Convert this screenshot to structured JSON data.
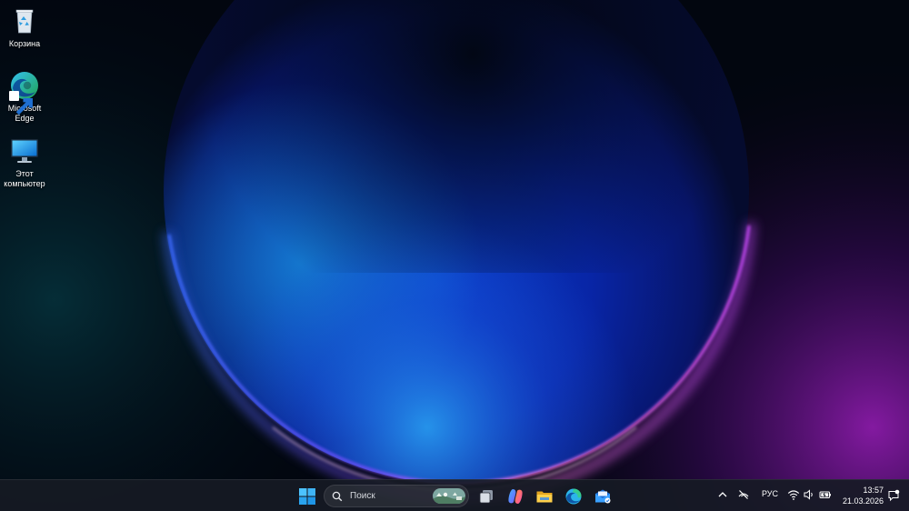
{
  "desktop": {
    "icons": [
      {
        "id": "recycle-bin",
        "label": "Корзина",
        "icon": "recycle-bin-icon"
      },
      {
        "id": "microsoft-edge",
        "label": "Microsoft Edge",
        "icon": "edge-icon"
      },
      {
        "id": "this-pc",
        "label": "Этот компьютер",
        "icon": "monitor-icon"
      }
    ]
  },
  "taskbar": {
    "start_icon": "windows-logo-icon",
    "search": {
      "placeholder": "Поиск",
      "icon": "search-icon",
      "highlight_icon": "search-highlight-icon"
    },
    "pinned": [
      {
        "name": "task-view",
        "icon": "task-view-icon"
      },
      {
        "name": "copilot",
        "icon": "copilot-icon"
      },
      {
        "name": "file-explorer",
        "icon": "folder-icon"
      },
      {
        "name": "edge",
        "icon": "edge-icon"
      },
      {
        "name": "mail",
        "icon": "mail-icon"
      }
    ],
    "tray": {
      "overflow_icon": "chevron-up-icon",
      "location_icon": "location-off-icon",
      "language": "РУС",
      "wifi_icon": "wifi-icon",
      "volume_icon": "volume-icon",
      "battery_icon": "battery-icon",
      "notification_icon": "notification-icon"
    },
    "clock": {
      "time": "13:57",
      "date": "21.03.2026"
    }
  },
  "colors": {
    "taskbar_bg": "#161a24",
    "wallpaper_glow_blue": "#1447c8",
    "wallpaper_glow_magenta": "#c02ad6",
    "accent": "#0078d4"
  }
}
